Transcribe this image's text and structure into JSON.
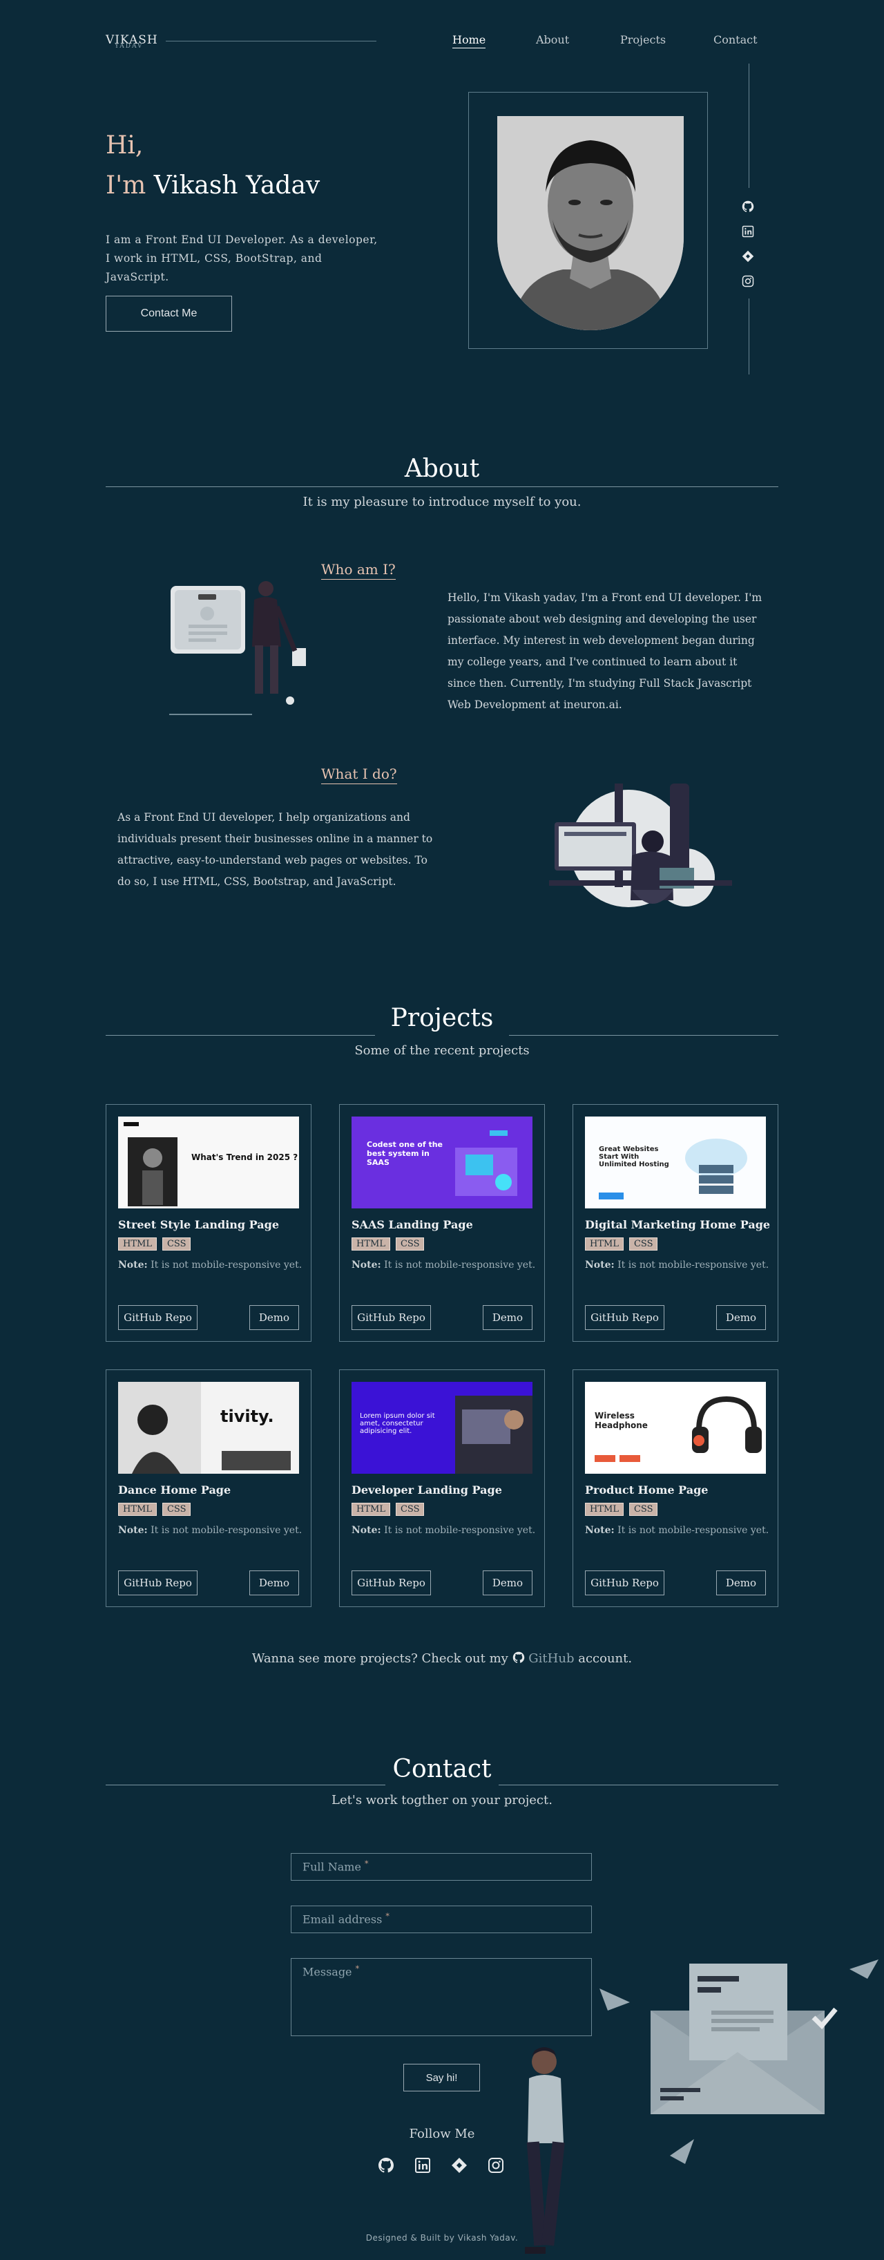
{
  "nav": {
    "logo": "VIKASH",
    "logo_sub": "YADAV",
    "items": [
      {
        "label": "Home",
        "active": true
      },
      {
        "label": "About",
        "active": false
      },
      {
        "label": "Projects",
        "active": false
      },
      {
        "label": "Contact",
        "active": false
      }
    ]
  },
  "hero": {
    "greeting": "Hi,",
    "im": "I'm",
    "name": "Vikash Yadav",
    "description": "I am a Front End UI Developer. As a developer, I work in HTML, CSS, BootStrap, and JavaScript.",
    "button": "Contact Me"
  },
  "social_icons": [
    "github-icon",
    "linkedin-icon",
    "codepen-icon",
    "instagram-icon"
  ],
  "about": {
    "title": "About",
    "subtitle": "It is my pleasure to introduce myself to you.",
    "who_heading": "Who am I?",
    "who_text": "Hello, I'm Vikash yadav, I'm a Front end UI developer. I'm passionate about web designing and developing the user interface. My interest in web development began during my college years, and I've continued to learn about it since then. Currently, I'm studying Full Stack Javascript Web Development at ineuron.ai.",
    "what_heading": "What I do?",
    "what_text": "As a Front End UI developer, I help organizations and individuals present their businesses online in a manner to attractive, easy-to-understand web pages or websites. To do so, I use HTML, CSS, Bootstrap, and JavaScript."
  },
  "projects": {
    "title": "Projects",
    "subtitle": "Some of the recent projects",
    "note_label": "Note:",
    "note_text": "It is not mobile-responsive yet.",
    "repo_label": "GitHub Repo",
    "demo_label": "Demo",
    "cards": [
      {
        "title": "Street Style Landing Page",
        "tags": [
          "HTML",
          "CSS"
        ],
        "thumb_heading": "What's Trend in 2025 ?"
      },
      {
        "title": "SAAS Landing Page",
        "tags": [
          "HTML",
          "CSS"
        ],
        "thumb_heading": "Codest one of the best system in SAAS"
      },
      {
        "title": "Digital Marketing Home Page",
        "tags": [
          "HTML",
          "CSS"
        ],
        "thumb_heading": "Great Websites Start With Unlimited Hosting"
      },
      {
        "title": "Dance Home Page",
        "tags": [
          "HTML",
          "CSS"
        ],
        "thumb_heading": "tivity."
      },
      {
        "title": "Developer Landing Page",
        "tags": [
          "HTML",
          "CSS"
        ],
        "thumb_heading": "Lorem ipsum dolor sit amet, consectetur adipisicing elit."
      },
      {
        "title": "Product Home Page",
        "tags": [
          "HTML",
          "CSS"
        ],
        "thumb_heading": "Wireless Headphone"
      }
    ],
    "more_prefix": "Wanna see more projects? Check out my",
    "more_link": "GitHub",
    "more_suffix": "account."
  },
  "contact": {
    "title": "Contact",
    "subtitle": "Let's work togther on your project.",
    "name_placeholder": "Full Name",
    "email_placeholder": "Email address",
    "message_placeholder": "Message",
    "required_mark": "*",
    "submit": "Say hi!",
    "follow": "Follow Me"
  },
  "footer": "Designed & Built by Vikash Yadav.",
  "colors": {
    "background": "#0c2a39",
    "accent": "#e7c3b1",
    "tag": "#c9b3a8"
  }
}
